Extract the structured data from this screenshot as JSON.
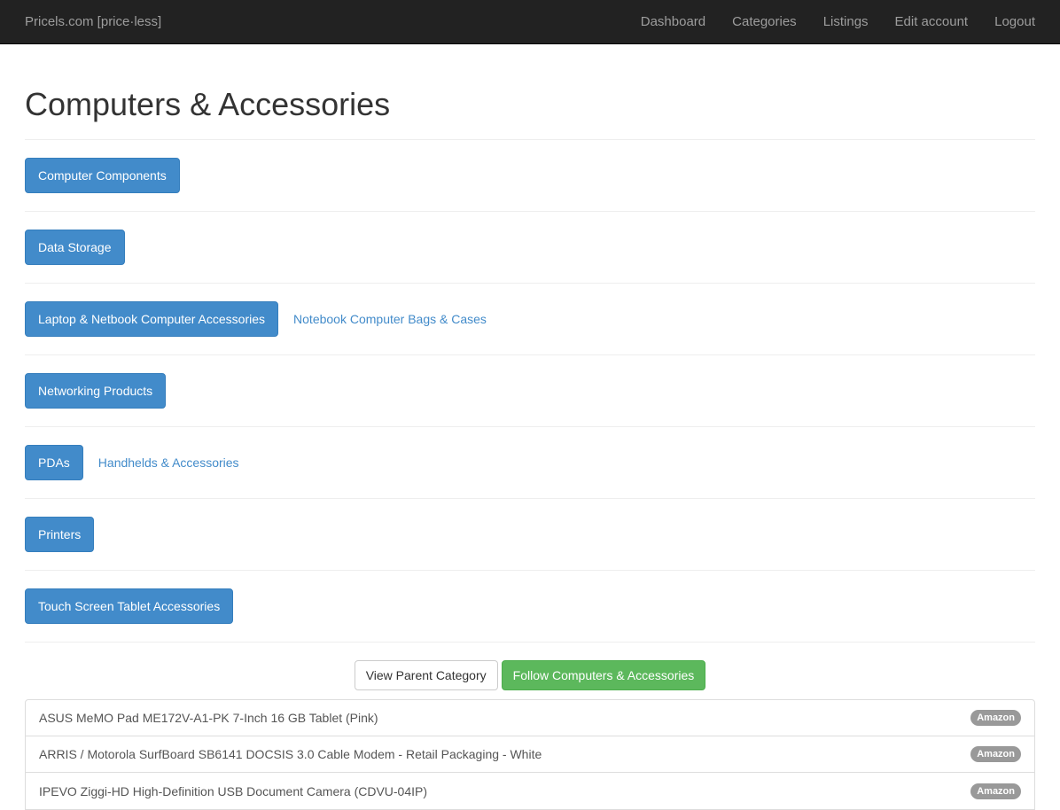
{
  "navbar": {
    "brand": "Pricels.com [price·less]",
    "links": [
      "Dashboard",
      "Categories",
      "Listings",
      "Edit account",
      "Logout"
    ]
  },
  "page": {
    "title": "Computers & Accessories"
  },
  "categories": [
    {
      "label": "Computer Components",
      "sublinks": []
    },
    {
      "label": "Data Storage",
      "sublinks": []
    },
    {
      "label": "Laptop & Netbook Computer Accessories",
      "sublinks": [
        "Notebook Computer Bags & Cases"
      ]
    },
    {
      "label": "Networking Products",
      "sublinks": []
    },
    {
      "label": "PDAs",
      "sublinks": [
        "Handhelds & Accessories"
      ]
    },
    {
      "label": "Printers",
      "sublinks": []
    },
    {
      "label": "Touch Screen Tablet Accessories",
      "sublinks": []
    }
  ],
  "actions": {
    "view_parent": "View Parent Category",
    "follow": "Follow Computers & Accessories"
  },
  "listings": [
    {
      "title": "ASUS MeMO Pad ME172V-A1-PK 7-Inch 16 GB Tablet (Pink)",
      "source": "Amazon"
    },
    {
      "title": "ARRIS / Motorola SurfBoard SB6141 DOCSIS 3.0 Cable Modem - Retail Packaging - White",
      "source": "Amazon"
    },
    {
      "title": "IPEVO Ziggi-HD High-Definition USB Document Camera (CDVU-04IP)",
      "source": "Amazon"
    }
  ],
  "colors": {
    "navbar_bg": "#222222",
    "primary": "#428bca",
    "success": "#5cb85c",
    "badge": "#999999"
  }
}
